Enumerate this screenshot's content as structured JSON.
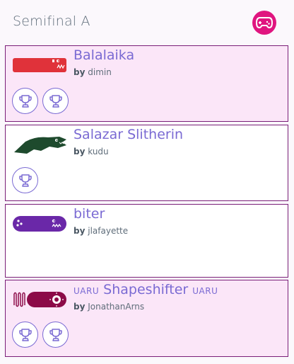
{
  "header": {
    "title": "Semifinal A",
    "icon": "gamepad-icon"
  },
  "entries": [
    {
      "name": "Balalaika",
      "by": "by",
      "author": "dimin",
      "trophies": 2,
      "highlighted": true,
      "snake_color": "#e0323a"
    },
    {
      "name": "Salazar Slitherin",
      "by": "by",
      "author": "kudu",
      "trophies": 1,
      "highlighted": false,
      "snake_color": "#1e4a2d"
    },
    {
      "name": "biter",
      "by": "by",
      "author": "jlafayette",
      "trophies": 0,
      "highlighted": false,
      "snake_color": "#6a28a8"
    },
    {
      "name": "Shapeshifter",
      "prefix": "UARU",
      "suffix": "UARU",
      "by": "by",
      "author": "JonathanArns",
      "trophies": 2,
      "highlighted": true,
      "snake_color": "#8c0a48"
    }
  ],
  "colors": {
    "accent": "#e0157f",
    "border": "#7a1f78",
    "name": "#7a6ad3",
    "highlight_bg": "#fbe6f8"
  }
}
